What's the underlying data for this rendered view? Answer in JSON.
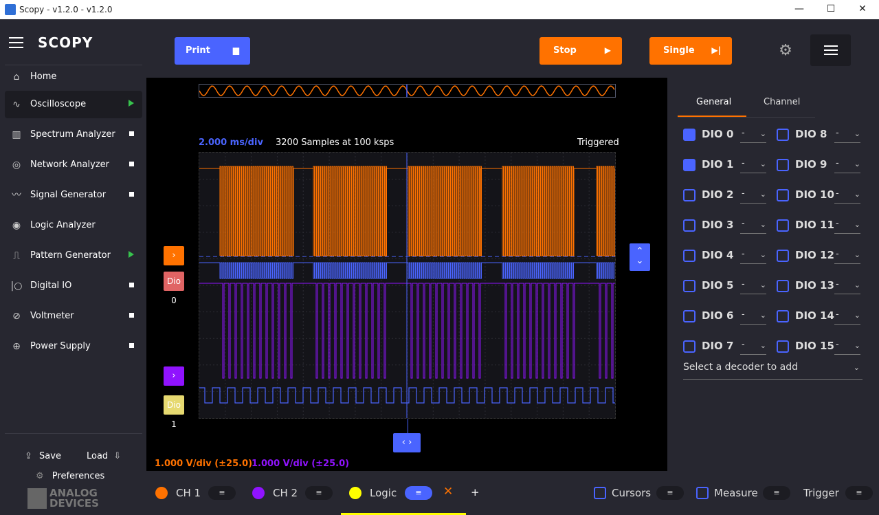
{
  "window": {
    "title": "Scopy - v1.2.0 - v1.2.0",
    "minimize": "—",
    "maximize": "☐",
    "close": "✕"
  },
  "brand": {
    "logo": "SCOPY",
    "vendor_line1": "ANALOG",
    "vendor_line2": "DEVICES"
  },
  "nav": [
    {
      "label": "Home",
      "icon": "home-icon",
      "marker": "none"
    },
    {
      "label": "Oscilloscope",
      "icon": "oscilloscope-icon",
      "marker": "play"
    },
    {
      "label": "Spectrum Analyzer",
      "icon": "spectrum-icon",
      "marker": "square"
    },
    {
      "label": "Network Analyzer",
      "icon": "network-icon",
      "marker": "square"
    },
    {
      "label": "Signal Generator",
      "icon": "signal-icon",
      "marker": "square"
    },
    {
      "label": "Logic Analyzer",
      "icon": "logic-icon",
      "marker": "none"
    },
    {
      "label": "Pattern Generator",
      "icon": "pattern-icon",
      "marker": "play"
    },
    {
      "label": "Digital IO",
      "icon": "digital-io-icon",
      "marker": "square"
    },
    {
      "label": "Voltmeter",
      "icon": "voltmeter-icon",
      "marker": "square"
    },
    {
      "label": "Power Supply",
      "icon": "power-icon",
      "marker": "square"
    }
  ],
  "side_bottom": {
    "save": "Save",
    "load": "Load",
    "preferences": "Preferences"
  },
  "toolbar": {
    "print": "Print",
    "stop": "Stop",
    "single": "Single"
  },
  "plot": {
    "time_div": "2.000 ms/div",
    "samples": "3200 Samples at 100 ksps",
    "status": "Triggered",
    "ch1_vdiv": "1.000 V/div (±25.0)",
    "ch2_vdiv": "1.000 V/div (±25.0)",
    "dio0_tag": "Dio 0",
    "dio1_tag": "Dio 1"
  },
  "settings": {
    "tabs": [
      "General",
      "Channel"
    ],
    "dio_left": [
      {
        "label": "DIO 0",
        "checked": true,
        "value": "-"
      },
      {
        "label": "DIO 1",
        "checked": true,
        "value": "-"
      },
      {
        "label": "DIO 2",
        "checked": false,
        "value": "-"
      },
      {
        "label": "DIO 3",
        "checked": false,
        "value": "-"
      },
      {
        "label": "DIO 4",
        "checked": false,
        "value": "-"
      },
      {
        "label": "DIO 5",
        "checked": false,
        "value": "-"
      },
      {
        "label": "DIO 6",
        "checked": false,
        "value": "-"
      },
      {
        "label": "DIO 7",
        "checked": false,
        "value": "-"
      }
    ],
    "dio_right": [
      {
        "label": "DIO 8",
        "checked": false,
        "value": "-"
      },
      {
        "label": "DIO 9",
        "checked": false,
        "value": "-"
      },
      {
        "label": "DIO 10",
        "checked": false,
        "value": "-"
      },
      {
        "label": "DIO 11",
        "checked": false,
        "value": "-"
      },
      {
        "label": "DIO 12",
        "checked": false,
        "value": "-"
      },
      {
        "label": "DIO 13",
        "checked": false,
        "value": "-"
      },
      {
        "label": "DIO 14",
        "checked": false,
        "value": "-"
      },
      {
        "label": "DIO 15",
        "checked": false,
        "value": "-"
      }
    ],
    "decoder_placeholder": "Select a decoder to add"
  },
  "bottom": {
    "ch1": "CH 1",
    "ch2": "CH 2",
    "logic": "Logic",
    "cursors": "Cursors",
    "measure": "Measure",
    "trigger": "Trigger",
    "add": "+",
    "remove": "✕"
  },
  "colors": {
    "ch1": "#ff7200",
    "ch2": "#9013fe",
    "logic": "#ffff00",
    "accent": "#4a64ff",
    "dio0": "#e06464",
    "dio1": "#e6d970"
  }
}
